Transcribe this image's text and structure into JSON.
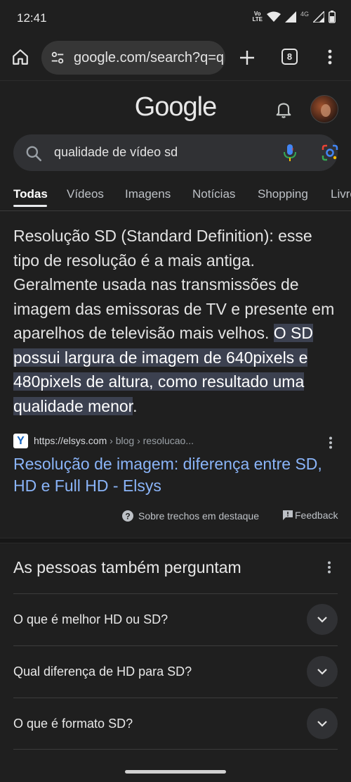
{
  "status_bar": {
    "time": "12:41",
    "volte_top": "Vo",
    "volte_mid": "LTE",
    "network_label": "4G",
    "icons": [
      "volte-icon",
      "wifi-icon",
      "signal-icon",
      "signal-icon",
      "battery-icon"
    ]
  },
  "browser": {
    "url": "google.com/search?q=q",
    "tab_count": "8"
  },
  "google": {
    "logo": "Google",
    "search_query": "qualidade de vídeo sd",
    "tabs": [
      "Todas",
      "Vídeos",
      "Imagens",
      "Notícias",
      "Shopping",
      "Livros"
    ],
    "active_tab": "Todas"
  },
  "featured_snippet": {
    "text_plain": "Resolução SD (Standard Definition): esse tipo de resolução é a mais antiga. Geralmente usada nas transmissões de imagem das emissoras de TV e presente em aparelhos de televisão mais velhos. ",
    "text_highlighted": "O SD possui largura de imagem de 640pixels e 480pixels de altura, como resultado uma qualidade menor",
    "text_end": ".",
    "source_favicon": "Y",
    "source_url": "https://elsys.com",
    "source_crumbs": " › blog › resolucao...",
    "result_title": "Resolução de imagem: diferença entre SD, HD e Full HD - Elsys",
    "about_label": "Sobre trechos em destaque",
    "feedback_label": "Feedback"
  },
  "people_also_ask": {
    "title": "As pessoas também perguntam",
    "questions": [
      "O que é melhor HD ou SD?",
      "Qual diferença de HD para SD?",
      "O que é formato SD?"
    ]
  },
  "colors": {
    "background": "#1f1f1f",
    "link": "#8ab4f8",
    "highlight": "#3c4150",
    "search_box": "#303134"
  }
}
